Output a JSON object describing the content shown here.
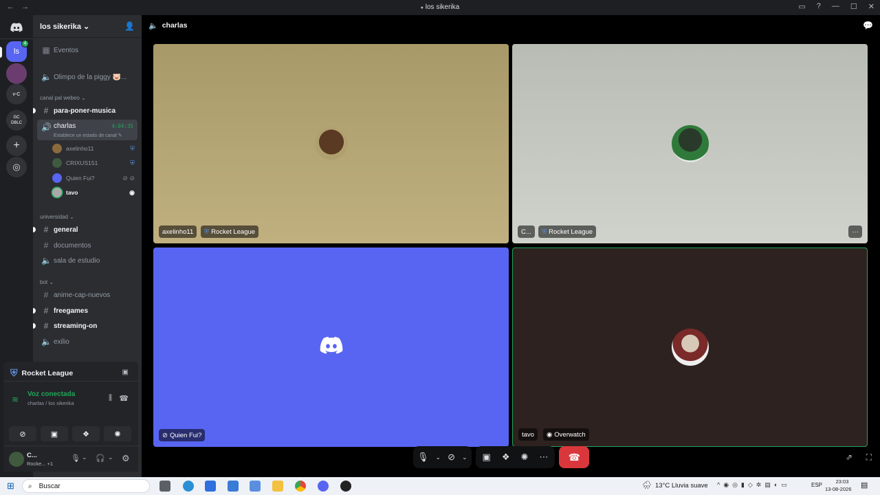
{
  "titlebar": {
    "back": "←",
    "forward": "→",
    "title": "los sikerika"
  },
  "rail": {
    "server_initials": "ls",
    "badge": "4",
    "srv2": "v-C",
    "srv3_line1": "GC",
    "srv3_line2": "DBLC"
  },
  "guild": {
    "name": "los sikerika ⌄"
  },
  "channels": {
    "events": "Eventos",
    "olimpo": "Olimpo de la piggy 🐷...",
    "cat1": "canal pal webeo ⌄",
    "para_poner_musica": "para-poner-musica",
    "charlas": "charlas",
    "charlas_time": "4:04:35",
    "charlas_status": "Establece un estado de canal ✎",
    "cat2": "universidad ⌄",
    "general": "general",
    "documentos": "documentos",
    "sala_de_estudio": "sala de estudio",
    "cat3": "bot ⌄",
    "anime": "anime-cap-nuevos",
    "freegames": "freegames",
    "streaming": "streaming-on",
    "exilio": "exilio"
  },
  "voice_users": [
    "axelinho11",
    "CRIXUS151",
    "Quien Fui?",
    "tavo"
  ],
  "activity": {
    "game": "Rocket League",
    "voice_status": "Voz conectada",
    "voice_location": "charlas / los sikerika",
    "user_name": "C...",
    "user_sub": "Rocke... +1"
  },
  "main": {
    "channel": "charlas"
  },
  "tiles": {
    "t1_name": "axelinho11",
    "t1_game": "Rocket League",
    "t2_name": "C...",
    "t2_game": "Rocket League",
    "t3_name": "Quien Fui?",
    "t4_name": "tavo",
    "t4_game": "Overwatch",
    "more": "···"
  },
  "taskbar": {
    "search": "Buscar",
    "weather": "13°C  Lluvia suave",
    "lang": "ESP",
    "time": "23:03",
    "date": "13-08-2026"
  },
  "colors": {
    "accent": "#5865f2",
    "hangup": "#da373c",
    "connected": "#23a55a"
  }
}
